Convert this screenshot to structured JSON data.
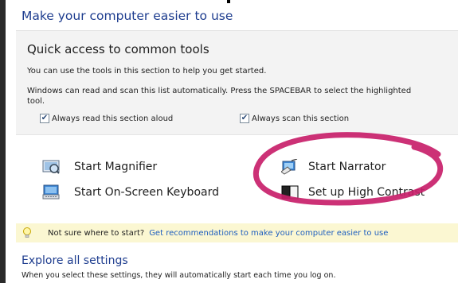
{
  "page": {
    "title": "Make your computer easier to use"
  },
  "quick_access": {
    "title": "Quick access to common tools",
    "line1": "You can use the tools in this section to help you get started.",
    "line2": "Windows can read and scan this list automatically.  Press the SPACEBAR to select the highlighted",
    "line3": "tool.",
    "checkboxes": [
      {
        "label": "Always read this section aloud",
        "checked": true
      },
      {
        "label": "Always scan this section",
        "checked": true
      }
    ]
  },
  "tools": [
    {
      "label": "Start Magnifier",
      "icon": "magnifier-icon"
    },
    {
      "label": "Start On-Screen Keyboard",
      "icon": "keyboard-icon"
    },
    {
      "label": "Start Narrator",
      "icon": "narrator-icon"
    },
    {
      "label": "Set up High Contrast",
      "icon": "high-contrast-icon"
    }
  ],
  "tip": {
    "prefix": "Not sure where to start?",
    "link": "Get recommendations to make your computer easier to use"
  },
  "explore": {
    "title": "Explore all settings",
    "description": "When you select these settings, they will automatically start each time you log on."
  },
  "colors": {
    "heading_blue": "#1e3d8f",
    "link_blue": "#1f5fbf",
    "tip_background": "#fbf7d2",
    "section_background": "#f3f3f3",
    "annotation_ink": "#c8206a"
  }
}
